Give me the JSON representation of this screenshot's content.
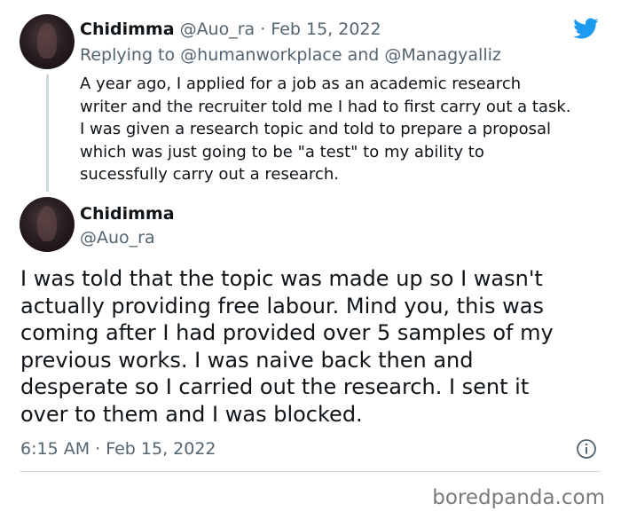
{
  "reply_tweet": {
    "author_name": "Chidimma",
    "author_handle": "@Auo_ra",
    "separator": "·",
    "date": "Feb 15, 2022",
    "replying_to_prefix": "Replying to",
    "replying_to_1": "@humanworkplace",
    "replying_and": "and",
    "replying_to_2": "@Managyalliz",
    "text": "A year ago, I applied for a job as an academic research\nwriter and the recruiter told me I had to first carry out a task.\nI was given a research topic and told to prepare a proposal\nwhich was just going to be \"a test\" to my ability to\nsucessfully carry out a research."
  },
  "main_tweet": {
    "author_name": "Chidimma",
    "author_handle": "@Auo_ra",
    "text": "I was told that the topic was made up so I wasn't\nactually providing free labour. Mind you, this was\ncoming after I had provided over 5 samples of my\nprevious works. I was naive back then and\ndesperate so I carried out the research. I sent it\nover to them and I was blocked.",
    "timestamp": "6:15 AM · Feb 15, 2022"
  },
  "watermark": "boredpanda.com",
  "icons": {
    "brand": "twitter-bird-icon",
    "info": "info-icon"
  },
  "colors": {
    "twitter_blue": "#1d9bf0",
    "muted": "#536471",
    "text": "#0f1419"
  }
}
